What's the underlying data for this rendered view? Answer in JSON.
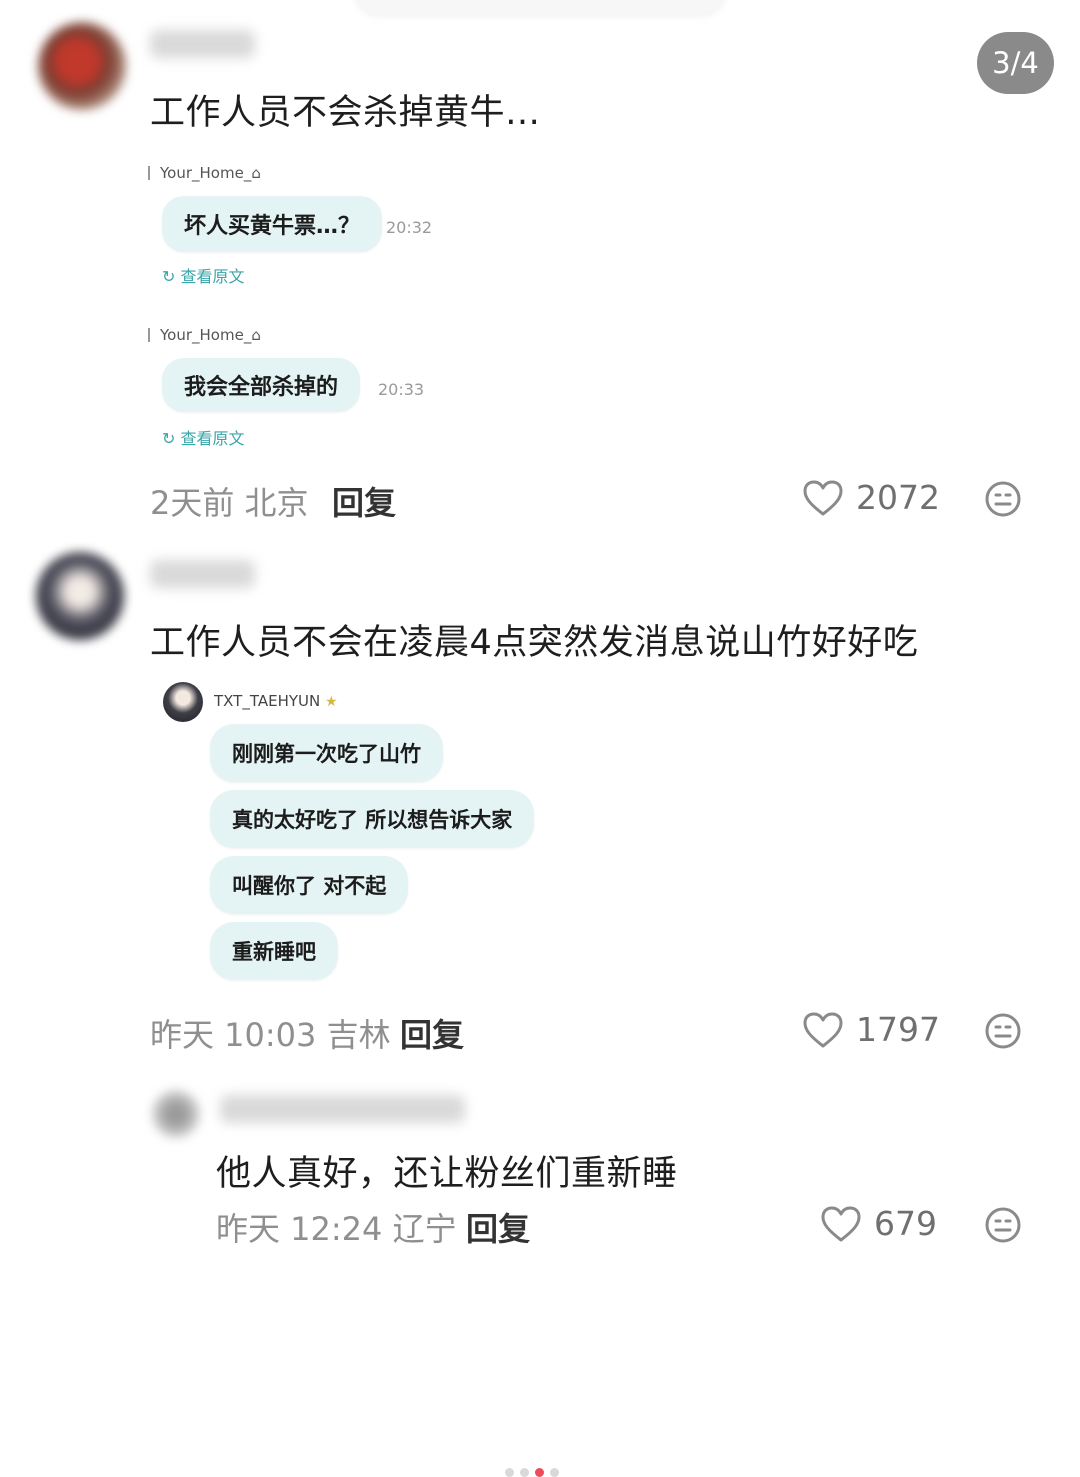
{
  "page_indicator": "3/4",
  "comments": [
    {
      "text": "工作人员不会杀掉黄牛…",
      "meta": "2天前 北京",
      "reply_label": "回复",
      "likes": "2072",
      "embedded_messages": [
        {
          "sender": "Your_Home_⌂",
          "text": "坏人买黄牛票…？",
          "time": "20:32",
          "translate": "查看原文"
        },
        {
          "sender": "Your_Home_⌂",
          "text": "我会全部杀掉的",
          "time": "20:33",
          "translate": "查看原文"
        }
      ]
    },
    {
      "text": "工作人员不会在凌晨4点突然发消息说山竹好好吃",
      "meta": "昨天 10:03 吉林",
      "reply_label": "回复",
      "likes": "1797",
      "embedded_sender": "TXT_TAEHYUN",
      "embedded_messages": [
        "刚刚第一次吃了山竹",
        "真的太好吃了 所以想告诉大家",
        "叫醒你了 对不起",
        "重新睡吧"
      ]
    },
    {
      "text": "他人真好，还让粉丝们重新睡",
      "meta": "昨天 12:24 辽宁",
      "reply_label": "回复",
      "likes": "679"
    }
  ],
  "icons": {
    "like": "heart-icon",
    "emoji": "neutral-face-icon",
    "translate": "refresh-icon",
    "star": "star-icon"
  },
  "colors": {
    "bubble": "#e4f3f4",
    "translate": "#3aa5a9",
    "indicator_bg": "#8a8a8a",
    "active_dot": "#ef4c5a"
  }
}
